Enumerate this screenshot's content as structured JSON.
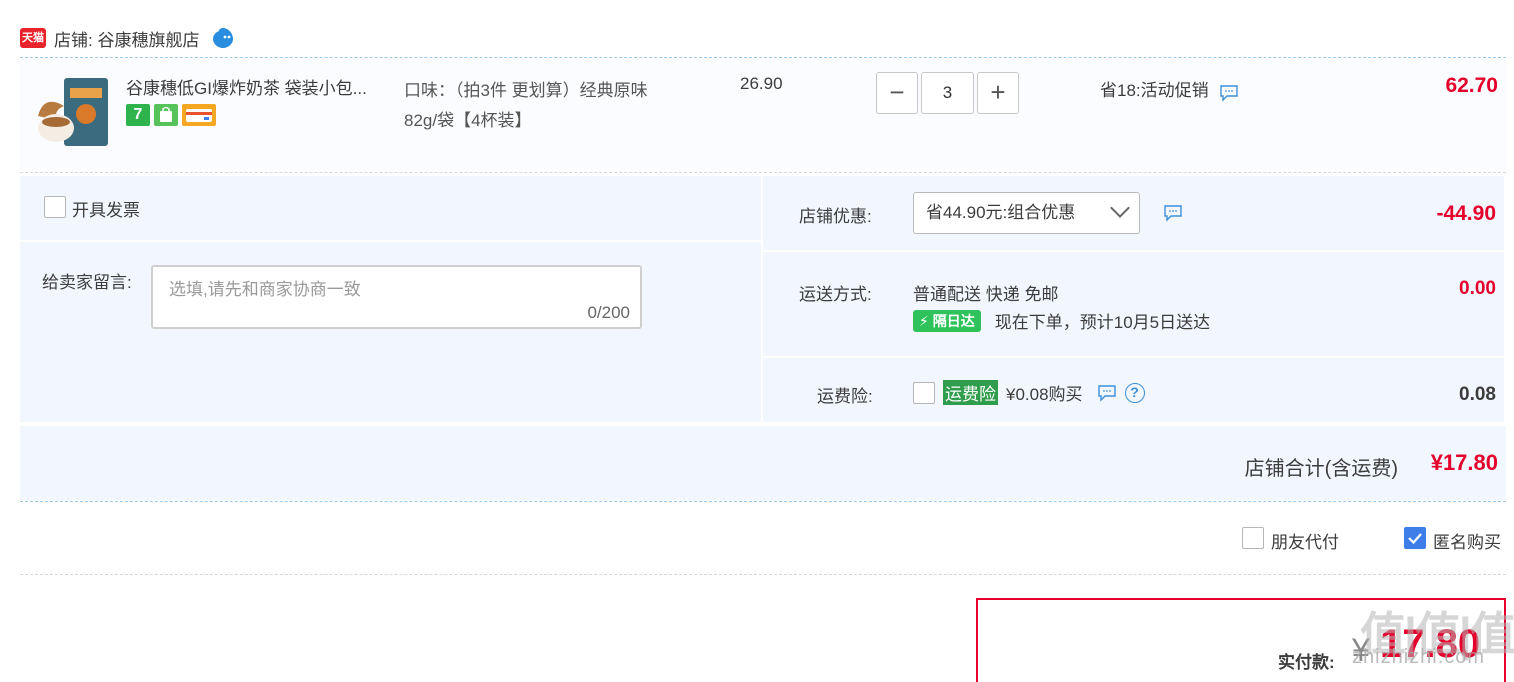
{
  "store": {
    "tmall_icon_text": "天猫",
    "label": "店铺: 谷康穗旗舰店",
    "wangwang_icon": "wangwang-chat-icon"
  },
  "item": {
    "title": "谷康穗低GI爆炸奶茶 袋装小包...",
    "badge_7": "7",
    "sku_line1": "口味：（拍3件 更划算）经典原味",
    "sku_line2": "82g/袋【4杯装】",
    "unit_price": "26.90",
    "qty_minus": "−",
    "quantity": "3",
    "qty_plus": "+",
    "promo": "省18:活动促销",
    "total": "62.70"
  },
  "invoice": {
    "label": "开具发票"
  },
  "message": {
    "label": "给卖家留言:",
    "placeholder": "选填,请先和商家协商一致",
    "count": "0/200"
  },
  "store_discount": {
    "label": "店铺优惠:",
    "selected": "省44.90元:组合优惠",
    "amount": "-44.90"
  },
  "shipping": {
    "label": "运送方式:",
    "method": "普通配送 快递 免邮",
    "tag": "隔日达",
    "eta": "现在下单，预计10月5日送达",
    "amount": "0.00"
  },
  "insurance": {
    "label": "运费险:",
    "tag": "运费险",
    "price": "¥0.08购买",
    "help": "?",
    "amount": "0.08"
  },
  "store_total": {
    "label": "店铺合计(含运费)",
    "value": "¥17.80"
  },
  "options": {
    "friend_pay": "朋友代付",
    "anonymous": "匿名购买",
    "anonymous_checked": true
  },
  "payment": {
    "label": "实付款:",
    "currency": "¥",
    "amount": "17.80"
  },
  "watermark": {
    "main": "值|值|值",
    "sub": "zhizhizhi.com"
  },
  "colors": {
    "price_red": "#e4002b",
    "panel_bg": "#f2f7ff",
    "checkbox_blue": "#3d7ee8",
    "tag_green": "#2ec25a"
  }
}
